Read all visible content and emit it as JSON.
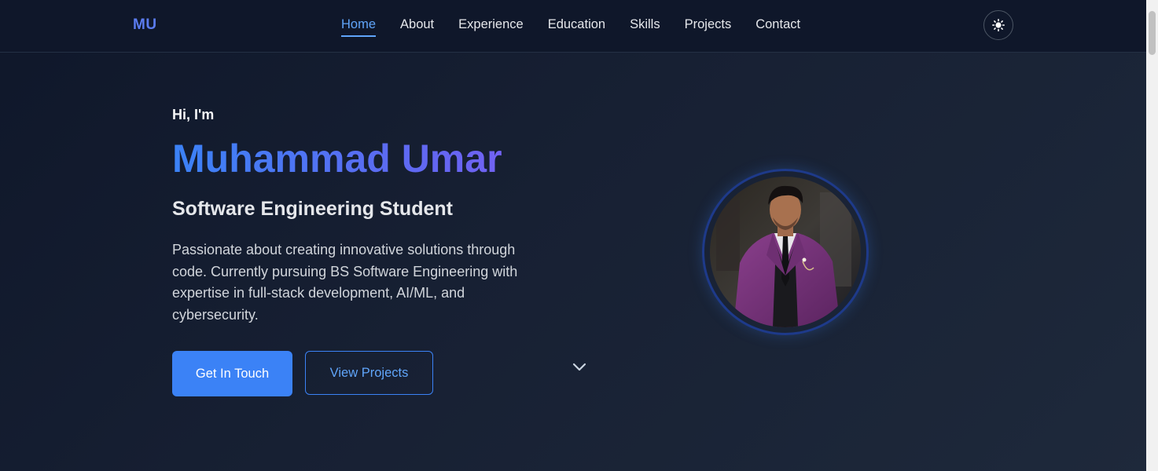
{
  "nav": {
    "logo": "MU",
    "links": [
      {
        "label": "Home",
        "active": true
      },
      {
        "label": "About",
        "active": false
      },
      {
        "label": "Experience",
        "active": false
      },
      {
        "label": "Education",
        "active": false
      },
      {
        "label": "Skills",
        "active": false
      },
      {
        "label": "Projects",
        "active": false
      },
      {
        "label": "Contact",
        "active": false
      }
    ],
    "theme_toggle_icon": "sun-icon"
  },
  "hero": {
    "greeting": "Hi, I'm",
    "name": "Muhammad Umar",
    "role": "Software Engineering Student",
    "bio": "Passionate about creating innovative solutions through code. Currently pursuing BS Software Engineering with expertise in full-stack development, AI/ML, and cybersecurity.",
    "primary_button": "Get In Touch",
    "secondary_button": "View Projects",
    "scroll_icon": "chevron-down-icon",
    "avatar_icon": "profile-photo"
  },
  "colors": {
    "accent": "#3b82f6",
    "accent_light": "#60a5fa",
    "gradient_end": "#8b5cf6",
    "background": "#0f172a"
  }
}
